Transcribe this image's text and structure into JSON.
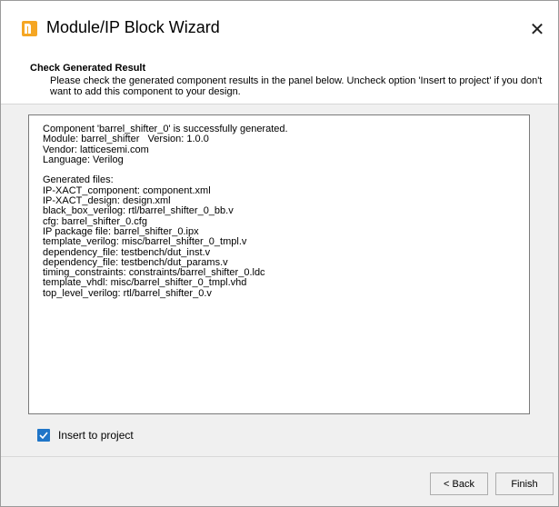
{
  "window": {
    "title": "Module/IP Block Wizard",
    "app_icon": "lattice-radiant-icon",
    "close_glyph": "✕"
  },
  "header": {
    "title": "Check Generated Result",
    "description": "Please check the generated component results in the panel below. Uncheck option 'Insert to project' if you don't want to add this component to your design."
  },
  "results": {
    "lines": [
      "Component 'barrel_shifter_0' is successfully generated.",
      "Module: barrel_shifter   Version: 1.0.0",
      "Vendor: latticesemi.com",
      "Language: Verilog",
      "",
      "Generated files:",
      "IP-XACT_component: component.xml",
      "IP-XACT_design: design.xml",
      "black_box_verilog: rtl/barrel_shifter_0_bb.v",
      "cfg: barrel_shifter_0.cfg",
      "IP package file: barrel_shifter_0.ipx",
      "template_verilog: misc/barrel_shifter_0_tmpl.v",
      "dependency_file: testbench/dut_inst.v",
      "dependency_file: testbench/dut_params.v",
      "timing_constraints: constraints/barrel_shifter_0.ldc",
      "template_vhdl: misc/barrel_shifter_0_tmpl.vhd",
      "top_level_verilog: rtl/barrel_shifter_0.v"
    ]
  },
  "insert_option": {
    "label": "Insert to project",
    "checked": true
  },
  "buttons": {
    "back": "< Back",
    "finish": "Finish"
  },
  "colors": {
    "checkbox": "#1f75c8",
    "app_icon": "#f5a623",
    "dialog_bg": "#f0f0f0"
  }
}
